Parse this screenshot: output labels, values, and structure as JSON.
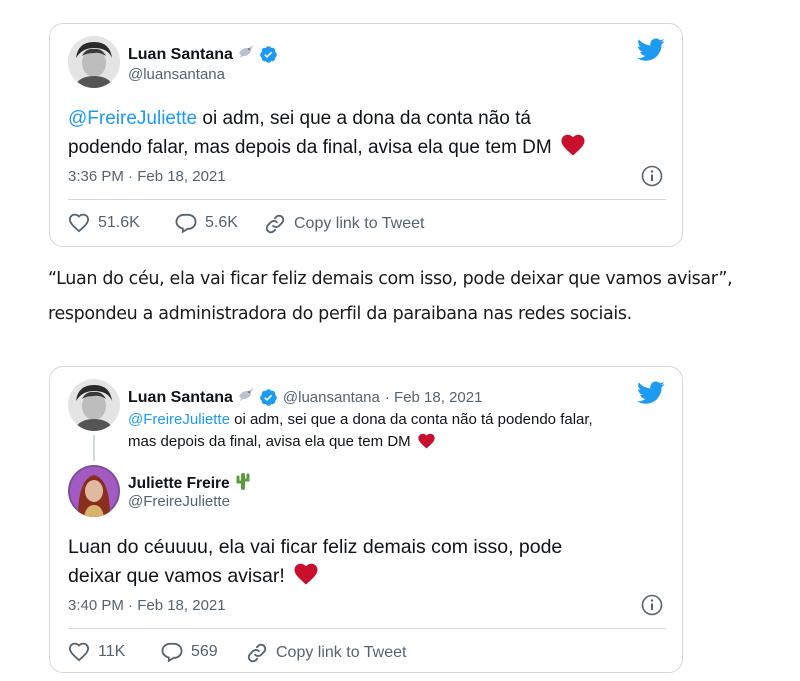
{
  "tweet1": {
    "author_name": "Luan Santana",
    "author_handle": "@luansantana",
    "mention": "@FreireJuliette",
    "text_line1": " oi adm, sei que a dona da conta não tá",
    "text_line2": "podendo falar, mas depois da final, avisa ela que tem DM",
    "timestamp": "3:36 PM · Feb 18, 2021",
    "likes": "51.6K",
    "replies": "5.6K",
    "copy_link": "Copy link to Tweet"
  },
  "article": {
    "line1": "“Luan do céu, ela vai ficar feliz demais com isso, pode deixar que vamos avisar”,",
    "line2": "respondeu a administradora do perfil da paraibana nas redes sociais."
  },
  "tweet2": {
    "parent": {
      "author_name": "Luan Santana",
      "author_handle": "@luansantana",
      "date": "· Feb 18, 2021",
      "mention": "@FreireJuliette",
      "text_line1": " oi adm, sei que a dona da conta não tá podendo falar,",
      "text_line2": "mas depois da final, avisa ela que tem DM"
    },
    "author_name": "Juliette Freire",
    "author_handle": "@FreireJuliette",
    "text_line1": "Luan do céuuuu, ela vai ficar feliz demais com isso, pode",
    "text_line2": "deixar que vamos avisar!",
    "timestamp": "3:40 PM · Feb 18, 2021",
    "likes": "11K",
    "replies": "569",
    "copy_link": "Copy link to Tweet"
  },
  "colors": {
    "twitter_blue": "#1d9bf0",
    "heart_red": "#e0245e",
    "secondary_text": "#536471",
    "border": "#cfd9de"
  },
  "icons": [
    "twitter-bird-icon",
    "verified-badge-icon",
    "dove-emoji-icon",
    "cactus-emoji-icon",
    "heart-icon",
    "reply-icon",
    "link-icon",
    "info-icon"
  ]
}
